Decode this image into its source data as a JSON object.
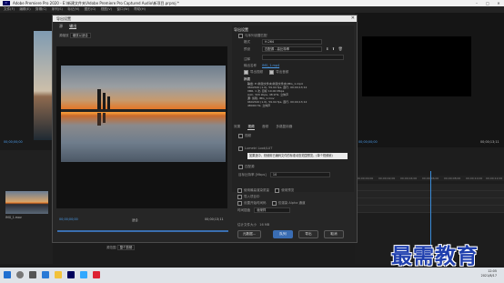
{
  "app": {
    "title": "Adobe Premiere Pro 2020 - E:\\新建文件夹\\Adobe Premiere Pro Captured Audio\\新项目.prproj *",
    "menu": [
      "文件(F)",
      "编辑(E)",
      "剪辑(C)",
      "序列(S)",
      "标记(M)",
      "图形(G)",
      "视图(V)",
      "窗口(W)",
      "帮助(H)"
    ]
  },
  "workspace": {
    "left_timecode": "00;00;00;00",
    "project_item": "IMG_1.mov",
    "right_timecode": "00;00;00;00",
    "right_timecode2": "00;00;13;11",
    "ruler": [
      "00;00;00;00",
      "00;00;02;00",
      "00;00;04;00",
      "00;00;06;00",
      "00;00;08;00",
      "00;00;10;00",
      "00;00;12;00"
    ]
  },
  "dialog": {
    "title": "导出设置",
    "source_tabs": [
      "源",
      "输出"
    ],
    "scale_label": "源缩放",
    "scale_value": "缩放以适合",
    "timecode_start": "00;00;00;00",
    "timecode_end": "00;00;13;11",
    "fit_label": "适合",
    "source_range_label": "源范围",
    "source_range_value": "整个剪辑",
    "export_settings_header": "导出设置",
    "match_label": "与序列设置匹配",
    "format_label": "格式",
    "format_value": "H.264",
    "preset_label": "预设",
    "preset_value": "匹配源 - 高比特率",
    "comment_label": "注释",
    "output_name_label": "输出名称",
    "output_name_value": "IMG_1.mp4",
    "export_video_label": "导出视频",
    "export_audio_label": "导出音频",
    "summary_header": "摘要",
    "summary_output_label": "输出",
    "summary_output_text": "E:\\新建文件夹\\新建文件夹\\IMG_1.mp4",
    "summary_output_detail1": "960x540 (1.0), 59.94 fps, 逐行, 00;00;13;12",
    "summary_output_detail2": "VBR, 1 次, 目标 10.00 Mbps",
    "summary_output_detail3": "AAC, 320 kbps, 48 kHz, 立体声",
    "summary_source_label": "源",
    "summary_source_text": "剪辑, IMG_1.mov",
    "summary_source_detail1": "960x540 (1.0), 59.94 fps, 逐行, 00;00;13;12",
    "summary_source_detail2": "48000 Hz, 立体声",
    "tabs": [
      "效果",
      "视频",
      "音频",
      "多路复用器",
      "字幕",
      "发布"
    ],
    "effects_header": "视频",
    "video_effect_label": "Lumetri Look/LUT",
    "highlighted_text": "如果选中，则使用已编码文件的标准动态范围预览。(单个视频帧)",
    "match_source_label": "匹配源",
    "output_size_label": "目标比特率 [Mbps]",
    "output_size_value": "10",
    "render_max_depth": "使用最高渲染质量",
    "use_previews": "使用预览",
    "set_start_timecode": "设置开始时间码",
    "use_frame_blending": "使用帧混合",
    "import_into_project": "导入项目中",
    "render_alpha": "仅渲染 Alpha 通道",
    "time_interpolation_label": "时间插值",
    "time_interpolation_value": "帧采样",
    "estimated_size_label": "估计文件大小",
    "estimated_size_value": "16 MB",
    "metadata_button": "元数据...",
    "queue_button": "队列",
    "export_button": "导出",
    "cancel_button": "取消"
  },
  "taskbar": {
    "time": "12:05",
    "date": "2021/8/17"
  },
  "watermark": "最需教育"
}
